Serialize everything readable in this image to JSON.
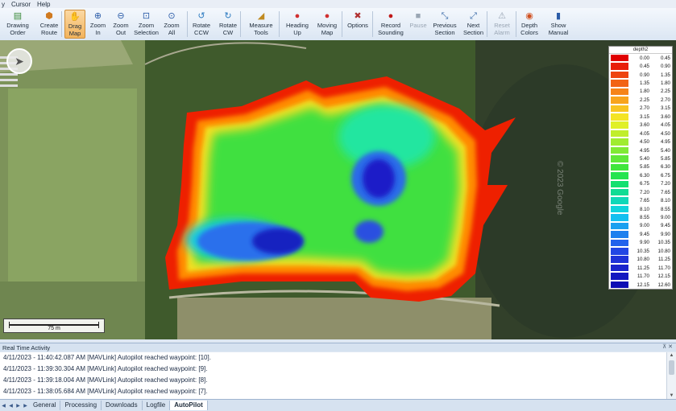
{
  "menu": {
    "items": [
      "y",
      "Cursor",
      "Help"
    ]
  },
  "ribbon": {
    "buttons": [
      {
        "label1": "Drawing",
        "label2": "Order",
        "icon": "layers-icon",
        "glyph": "▤",
        "color": "#3a8a3a"
      },
      {
        "label1": "Create",
        "label2": "Route",
        "icon": "route-icon",
        "glyph": "⬢",
        "color": "#d07a20"
      },
      {
        "label1": "Drag",
        "label2": "Map",
        "icon": "hand-icon",
        "glyph": "✋",
        "color": "#c05a10"
      },
      {
        "label1": "Zoom",
        "label2": "In",
        "icon": "zoom-in-icon",
        "glyph": "⊕",
        "color": "#2b5ca8"
      },
      {
        "label1": "Zoom",
        "label2": "Out",
        "icon": "zoom-out-icon",
        "glyph": "⊖",
        "color": "#2b5ca8"
      },
      {
        "label1": "Zoom",
        "label2": "Selection",
        "icon": "zoom-selection-icon",
        "glyph": "⊡",
        "color": "#2b5ca8"
      },
      {
        "label1": "Zoom",
        "label2": "All",
        "icon": "zoom-all-icon",
        "glyph": "⊙",
        "color": "#2b5ca8"
      },
      {
        "label1": "Rotate",
        "label2": "CCW",
        "icon": "rotate-ccw-icon",
        "glyph": "↺",
        "color": "#2b7ac0"
      },
      {
        "label1": "Rotate",
        "label2": "CW",
        "icon": "rotate-cw-icon",
        "glyph": "↻",
        "color": "#2b7ac0"
      },
      {
        "label1": "Measure",
        "label2": "Tools",
        "icon": "ruler-icon",
        "glyph": "◢",
        "color": "#c08a20"
      },
      {
        "label1": "Heading",
        "label2": "Up",
        "icon": "heading-up-icon",
        "glyph": "●",
        "color": "#d03030"
      },
      {
        "label1": "Moving",
        "label2": "Map",
        "icon": "moving-map-icon",
        "glyph": "●",
        "color": "#d03030"
      },
      {
        "label1": "Options",
        "label2": "",
        "icon": "options-icon",
        "glyph": "✖",
        "color": "#b03030"
      },
      {
        "label1": "Record",
        "label2": "Sounding",
        "icon": "record-icon",
        "glyph": "●",
        "color": "#c01818"
      },
      {
        "label1": "Pause",
        "label2": "",
        "icon": "pause-icon",
        "glyph": "■",
        "color": "#9aa6b4"
      },
      {
        "label1": "Previous",
        "label2": "Section",
        "icon": "previous-section-icon",
        "glyph": "⤡",
        "color": "#3a6aa8"
      },
      {
        "label1": "Next",
        "label2": "Section",
        "icon": "next-section-icon",
        "glyph": "⤢",
        "color": "#3a6aa8"
      },
      {
        "label1": "Reset",
        "label2": "Alarm",
        "icon": "reset-alarm-icon",
        "glyph": "⚠",
        "color": "#9aa6b4"
      },
      {
        "label1": "Depth",
        "label2": "Colors",
        "icon": "palette-icon",
        "glyph": "◉",
        "color": "#d05020"
      },
      {
        "label1": "Show",
        "label2": "Manual",
        "icon": "manual-icon",
        "glyph": "▮",
        "color": "#2b5ca8"
      }
    ]
  },
  "map": {
    "scale_label": "75 m",
    "watermark": "© 2023 Google",
    "legend": {
      "title": "depth2",
      "rows": [
        {
          "from": "0.00",
          "to": "0.45",
          "color": "#e00000"
        },
        {
          "from": "0.45",
          "to": "0.90",
          "color": "#e81e0a"
        },
        {
          "from": "0.90",
          "to": "1.35",
          "color": "#ee4410"
        },
        {
          "from": "1.35",
          "to": "1.80",
          "color": "#f26414"
        },
        {
          "from": "1.80",
          "to": "2.25",
          "color": "#f68418"
        },
        {
          "from": "2.25",
          "to": "2.70",
          "color": "#f8a41c"
        },
        {
          "from": "2.70",
          "to": "3.15",
          "color": "#f8c420"
        },
        {
          "from": "3.15",
          "to": "3.60",
          "color": "#f4e424"
        },
        {
          "from": "3.60",
          "to": "4.05",
          "color": "#e0f028"
        },
        {
          "from": "4.05",
          "to": "4.50",
          "color": "#c0ee2c"
        },
        {
          "from": "4.50",
          "to": "4.95",
          "color": "#a0ec30"
        },
        {
          "from": "4.95",
          "to": "5.40",
          "color": "#80ea34"
        },
        {
          "from": "5.40",
          "to": "5.85",
          "color": "#60e838"
        },
        {
          "from": "5.85",
          "to": "6.30",
          "color": "#40e63c"
        },
        {
          "from": "6.30",
          "to": "6.75",
          "color": "#24e450"
        },
        {
          "from": "6.75",
          "to": "7.20",
          "color": "#14e070"
        },
        {
          "from": "7.20",
          "to": "7.65",
          "color": "#10dc94"
        },
        {
          "from": "7.65",
          "to": "8.10",
          "color": "#10d8b8"
        },
        {
          "from": "8.10",
          "to": "8.55",
          "color": "#10d4dc"
        },
        {
          "from": "8.55",
          "to": "9.00",
          "color": "#14c0f0"
        },
        {
          "from": "9.00",
          "to": "9.45",
          "color": "#1aa0f0"
        },
        {
          "from": "9.45",
          "to": "9.90",
          "color": "#1e80ee"
        },
        {
          "from": "9.90",
          "to": "10.35",
          "color": "#2262ec"
        },
        {
          "from": "10.35",
          "to": "10.80",
          "color": "#2246e4"
        },
        {
          "from": "10.80",
          "to": "11.25",
          "color": "#1e32d8"
        },
        {
          "from": "11.25",
          "to": "11.70",
          "color": "#1a24cc"
        },
        {
          "from": "11.70",
          "to": "12.15",
          "color": "#1418c0"
        },
        {
          "from": "12.15",
          "to": "12.60",
          "color": "#0e0eb4"
        }
      ]
    }
  },
  "activity": {
    "title": "Real Time Activity",
    "pin": "⊼ ✕",
    "lines": [
      "4/11/2023 - 11:40:42.087 AM [MAVLink] Autopilot reached waypoint: [10].",
      "4/11/2023 - 11:39:30.304 AM [MAVLink] Autopilot reached waypoint: [9].",
      "4/11/2023 - 11:39:18.004 AM [MAVLink] Autopilot reached waypoint: [8].",
      "4/11/2023 - 11:38:05.684 AM [MAVLink] Autopilot reached waypoint: [7]."
    ]
  },
  "tabs": {
    "items": [
      "General",
      "Processing",
      "Downloads",
      "Logfile",
      "AutoPilot"
    ],
    "active": "AutoPilot"
  }
}
